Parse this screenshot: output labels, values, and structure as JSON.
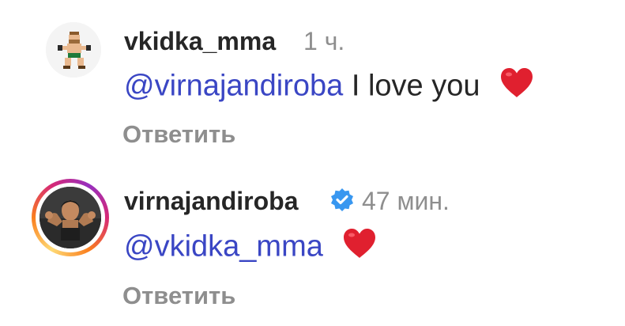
{
  "comments": [
    {
      "username": "vkidka_mma",
      "time": "1 ч.",
      "mention": "@virnajandiroba",
      "text": "I love you",
      "emoji": "heart",
      "reply_label": "Ответить",
      "verified": false
    },
    {
      "username": "virnajandiroba",
      "time": "47 мин.",
      "mention": "@vkidka_mma",
      "text": "",
      "emoji": "heart",
      "reply_label": "Ответить",
      "verified": true
    }
  ],
  "colors": {
    "mention": "#3a46c4",
    "username": "#262626",
    "meta": "#8e8e8e",
    "heart": "#e0202f",
    "verified": "#3897f0"
  }
}
